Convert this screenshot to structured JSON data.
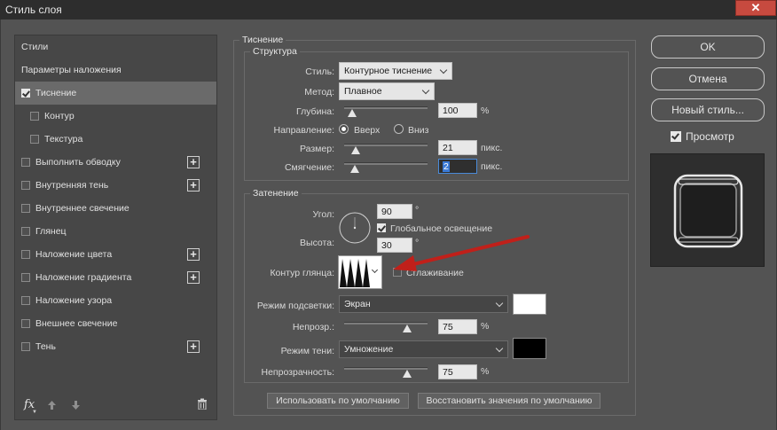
{
  "window": {
    "title": "Стиль слоя"
  },
  "left_panel": {
    "items": [
      {
        "label": "Стили",
        "checkbox": false,
        "checked": false,
        "plus": false,
        "selected": false,
        "indent": false
      },
      {
        "label": "Параметры наложения",
        "checkbox": false,
        "checked": false,
        "plus": false,
        "selected": false,
        "indent": false
      },
      {
        "label": "Тиснение",
        "checkbox": true,
        "checked": true,
        "plus": false,
        "selected": true,
        "indent": false
      },
      {
        "label": "Контур",
        "checkbox": true,
        "checked": false,
        "plus": false,
        "selected": false,
        "indent": true
      },
      {
        "label": "Текстура",
        "checkbox": true,
        "checked": false,
        "plus": false,
        "selected": false,
        "indent": true
      },
      {
        "label": "Выполнить обводку",
        "checkbox": true,
        "checked": false,
        "plus": true,
        "selected": false,
        "indent": false
      },
      {
        "label": "Внутренняя тень",
        "checkbox": true,
        "checked": false,
        "plus": true,
        "selected": false,
        "indent": false
      },
      {
        "label": "Внутреннее свечение",
        "checkbox": true,
        "checked": false,
        "plus": false,
        "selected": false,
        "indent": false
      },
      {
        "label": "Глянец",
        "checkbox": true,
        "checked": false,
        "plus": false,
        "selected": false,
        "indent": false
      },
      {
        "label": "Наложение цвета",
        "checkbox": true,
        "checked": false,
        "plus": true,
        "selected": false,
        "indent": false
      },
      {
        "label": "Наложение градиента",
        "checkbox": true,
        "checked": false,
        "plus": true,
        "selected": false,
        "indent": false
      },
      {
        "label": "Наложение узора",
        "checkbox": true,
        "checked": false,
        "plus": false,
        "selected": false,
        "indent": false
      },
      {
        "label": "Внешнее свечение",
        "checkbox": true,
        "checked": false,
        "plus": false,
        "selected": false,
        "indent": false
      },
      {
        "label": "Тень",
        "checkbox": true,
        "checked": false,
        "plus": true,
        "selected": false,
        "indent": false
      }
    ],
    "fx_label": "fx"
  },
  "bevel": {
    "title": "Тиснение",
    "structure": {
      "title": "Структура",
      "style_label": "Стиль:",
      "style_value": "Контурное тиснение",
      "method_label": "Метод:",
      "method_value": "Плавное",
      "depth_label": "Глубина:",
      "depth_value": "100",
      "depth_unit": "%",
      "depth_level": 0.1,
      "direction_label": "Направление:",
      "direction_up": "Вверх",
      "direction_down": "Вниз",
      "direction_selected": "up",
      "size_label": "Размер:",
      "size_value": "21",
      "size_unit": "пикс.",
      "size_level": 0.14,
      "soften_label": "Смягчение:",
      "soften_value": "2",
      "soften_unit": "пикс.",
      "soften_level": 0.13
    },
    "shading": {
      "title": "Затенение",
      "angle_label": "Угол:",
      "angle_value": "90",
      "angle_unit": "°",
      "global_light_label": "Глобальное освещение",
      "global_light_checked": true,
      "altitude_label": "Высота:",
      "altitude_value": "30",
      "altitude_unit": "°",
      "gloss_contour_label": "Контур глянца:",
      "antialias_label": "Сглаживание",
      "antialias_checked": false,
      "highlight_mode_label": "Режим подсветки:",
      "highlight_mode_value": "Экран",
      "highlight_color": "#ffffff",
      "highlight_opacity_label": "Непрозр.:",
      "highlight_opacity_value": "75",
      "highlight_opacity_unit": "%",
      "highlight_opacity_level": 0.75,
      "shadow_mode_label": "Режим тени:",
      "shadow_mode_value": "Умножение",
      "shadow_color": "#000000",
      "shadow_opacity_label": "Непрозрачность:",
      "shadow_opacity_value": "75",
      "shadow_opacity_unit": "%",
      "shadow_opacity_level": 0.75
    },
    "make_default_label": "Использовать по умолчанию",
    "reset_default_label": "Восстановить значения по умолчанию"
  },
  "right": {
    "ok_label": "OK",
    "cancel_label": "Отмена",
    "new_style_label": "Новый стиль...",
    "preview_label": "Просмотр",
    "preview_checked": true
  },
  "colors": {
    "annotation_arrow": "#c0201a",
    "selected_row": "#6a6a6a"
  }
}
